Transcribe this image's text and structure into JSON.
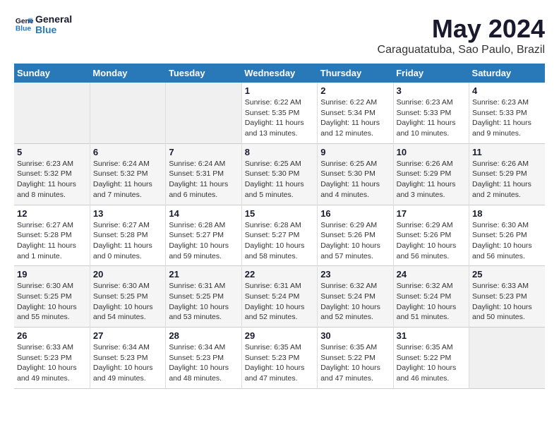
{
  "logo": {
    "line1": "General",
    "line2": "Blue"
  },
  "title": "May 2024",
  "subtitle": "Caraguatatuba, Sao Paulo, Brazil",
  "weekdays": [
    "Sunday",
    "Monday",
    "Tuesday",
    "Wednesday",
    "Thursday",
    "Friday",
    "Saturday"
  ],
  "weeks": [
    [
      {
        "day": "",
        "info": ""
      },
      {
        "day": "",
        "info": ""
      },
      {
        "day": "",
        "info": ""
      },
      {
        "day": "1",
        "info": "Sunrise: 6:22 AM\nSunset: 5:35 PM\nDaylight: 11 hours and 13 minutes."
      },
      {
        "day": "2",
        "info": "Sunrise: 6:22 AM\nSunset: 5:34 PM\nDaylight: 11 hours and 12 minutes."
      },
      {
        "day": "3",
        "info": "Sunrise: 6:23 AM\nSunset: 5:33 PM\nDaylight: 11 hours and 10 minutes."
      },
      {
        "day": "4",
        "info": "Sunrise: 6:23 AM\nSunset: 5:33 PM\nDaylight: 11 hours and 9 minutes."
      }
    ],
    [
      {
        "day": "5",
        "info": "Sunrise: 6:23 AM\nSunset: 5:32 PM\nDaylight: 11 hours and 8 minutes."
      },
      {
        "day": "6",
        "info": "Sunrise: 6:24 AM\nSunset: 5:32 PM\nDaylight: 11 hours and 7 minutes."
      },
      {
        "day": "7",
        "info": "Sunrise: 6:24 AM\nSunset: 5:31 PM\nDaylight: 11 hours and 6 minutes."
      },
      {
        "day": "8",
        "info": "Sunrise: 6:25 AM\nSunset: 5:30 PM\nDaylight: 11 hours and 5 minutes."
      },
      {
        "day": "9",
        "info": "Sunrise: 6:25 AM\nSunset: 5:30 PM\nDaylight: 11 hours and 4 minutes."
      },
      {
        "day": "10",
        "info": "Sunrise: 6:26 AM\nSunset: 5:29 PM\nDaylight: 11 hours and 3 minutes."
      },
      {
        "day": "11",
        "info": "Sunrise: 6:26 AM\nSunset: 5:29 PM\nDaylight: 11 hours and 2 minutes."
      }
    ],
    [
      {
        "day": "12",
        "info": "Sunrise: 6:27 AM\nSunset: 5:28 PM\nDaylight: 11 hours and 1 minute."
      },
      {
        "day": "13",
        "info": "Sunrise: 6:27 AM\nSunset: 5:28 PM\nDaylight: 11 hours and 0 minutes."
      },
      {
        "day": "14",
        "info": "Sunrise: 6:28 AM\nSunset: 5:27 PM\nDaylight: 10 hours and 59 minutes."
      },
      {
        "day": "15",
        "info": "Sunrise: 6:28 AM\nSunset: 5:27 PM\nDaylight: 10 hours and 58 minutes."
      },
      {
        "day": "16",
        "info": "Sunrise: 6:29 AM\nSunset: 5:26 PM\nDaylight: 10 hours and 57 minutes."
      },
      {
        "day": "17",
        "info": "Sunrise: 6:29 AM\nSunset: 5:26 PM\nDaylight: 10 hours and 56 minutes."
      },
      {
        "day": "18",
        "info": "Sunrise: 6:30 AM\nSunset: 5:26 PM\nDaylight: 10 hours and 56 minutes."
      }
    ],
    [
      {
        "day": "19",
        "info": "Sunrise: 6:30 AM\nSunset: 5:25 PM\nDaylight: 10 hours and 55 minutes."
      },
      {
        "day": "20",
        "info": "Sunrise: 6:30 AM\nSunset: 5:25 PM\nDaylight: 10 hours and 54 minutes."
      },
      {
        "day": "21",
        "info": "Sunrise: 6:31 AM\nSunset: 5:25 PM\nDaylight: 10 hours and 53 minutes."
      },
      {
        "day": "22",
        "info": "Sunrise: 6:31 AM\nSunset: 5:24 PM\nDaylight: 10 hours and 52 minutes."
      },
      {
        "day": "23",
        "info": "Sunrise: 6:32 AM\nSunset: 5:24 PM\nDaylight: 10 hours and 52 minutes."
      },
      {
        "day": "24",
        "info": "Sunrise: 6:32 AM\nSunset: 5:24 PM\nDaylight: 10 hours and 51 minutes."
      },
      {
        "day": "25",
        "info": "Sunrise: 6:33 AM\nSunset: 5:23 PM\nDaylight: 10 hours and 50 minutes."
      }
    ],
    [
      {
        "day": "26",
        "info": "Sunrise: 6:33 AM\nSunset: 5:23 PM\nDaylight: 10 hours and 49 minutes."
      },
      {
        "day": "27",
        "info": "Sunrise: 6:34 AM\nSunset: 5:23 PM\nDaylight: 10 hours and 49 minutes."
      },
      {
        "day": "28",
        "info": "Sunrise: 6:34 AM\nSunset: 5:23 PM\nDaylight: 10 hours and 48 minutes."
      },
      {
        "day": "29",
        "info": "Sunrise: 6:35 AM\nSunset: 5:23 PM\nDaylight: 10 hours and 47 minutes."
      },
      {
        "day": "30",
        "info": "Sunrise: 6:35 AM\nSunset: 5:22 PM\nDaylight: 10 hours and 47 minutes."
      },
      {
        "day": "31",
        "info": "Sunrise: 6:35 AM\nSunset: 5:22 PM\nDaylight: 10 hours and 46 minutes."
      },
      {
        "day": "",
        "info": ""
      }
    ]
  ]
}
